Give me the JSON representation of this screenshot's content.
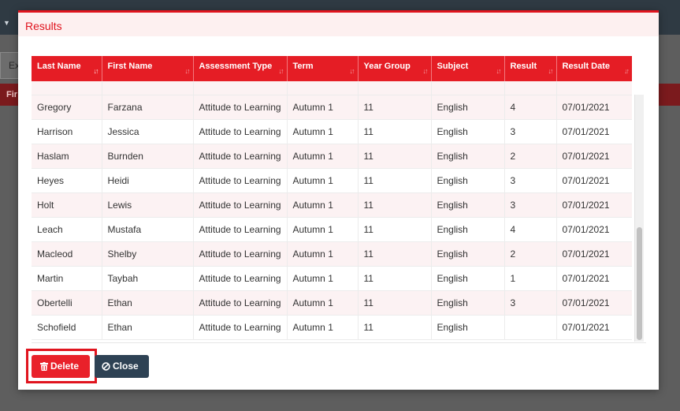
{
  "background": {
    "tab_label": "Ex",
    "redbar_label": "Fir"
  },
  "modal": {
    "title": "Results"
  },
  "table": {
    "columns": [
      "Last Name",
      "First Name",
      "Assessment Type",
      "Term",
      "Year Group",
      "Subject",
      "Result",
      "Result Date"
    ],
    "sorted_column": "Last Name",
    "rows": [
      [
        "Gregory",
        "Farzana",
        "Attitude to Learning",
        "Autumn 1",
        "11",
        "English",
        "4",
        "07/01/2021"
      ],
      [
        "Harrison",
        "Jessica",
        "Attitude to Learning",
        "Autumn 1",
        "11",
        "English",
        "3",
        "07/01/2021"
      ],
      [
        "Haslam",
        "Burnden",
        "Attitude to Learning",
        "Autumn 1",
        "11",
        "English",
        "2",
        "07/01/2021"
      ],
      [
        "Heyes",
        "Heidi",
        "Attitude to Learning",
        "Autumn 1",
        "11",
        "English",
        "3",
        "07/01/2021"
      ],
      [
        "Holt",
        "Lewis",
        "Attitude to Learning",
        "Autumn 1",
        "11",
        "English",
        "3",
        "07/01/2021"
      ],
      [
        "Leach",
        "Mustafa",
        "Attitude to Learning",
        "Autumn 1",
        "11",
        "English",
        "4",
        "07/01/2021"
      ],
      [
        "Macleod",
        "Shelby",
        "Attitude to Learning",
        "Autumn 1",
        "11",
        "English",
        "2",
        "07/01/2021"
      ],
      [
        "Martin",
        "Taybah",
        "Attitude to Learning",
        "Autumn 1",
        "11",
        "English",
        "1",
        "07/01/2021"
      ],
      [
        "Obertelli",
        "Ethan",
        "Attitude to Learning",
        "Autumn 1",
        "11",
        "English",
        "3",
        "07/01/2021"
      ],
      [
        "Schofield",
        "Ethan",
        "Attitude to Learning",
        "Autumn 1",
        "11",
        "English",
        "",
        "07/01/2021"
      ]
    ]
  },
  "buttons": {
    "delete_label": "Delete",
    "close_label": "Close"
  },
  "colors": {
    "accent": "#e51d25",
    "row_alt": "#fcf2f3",
    "close_button": "#2e4254"
  }
}
